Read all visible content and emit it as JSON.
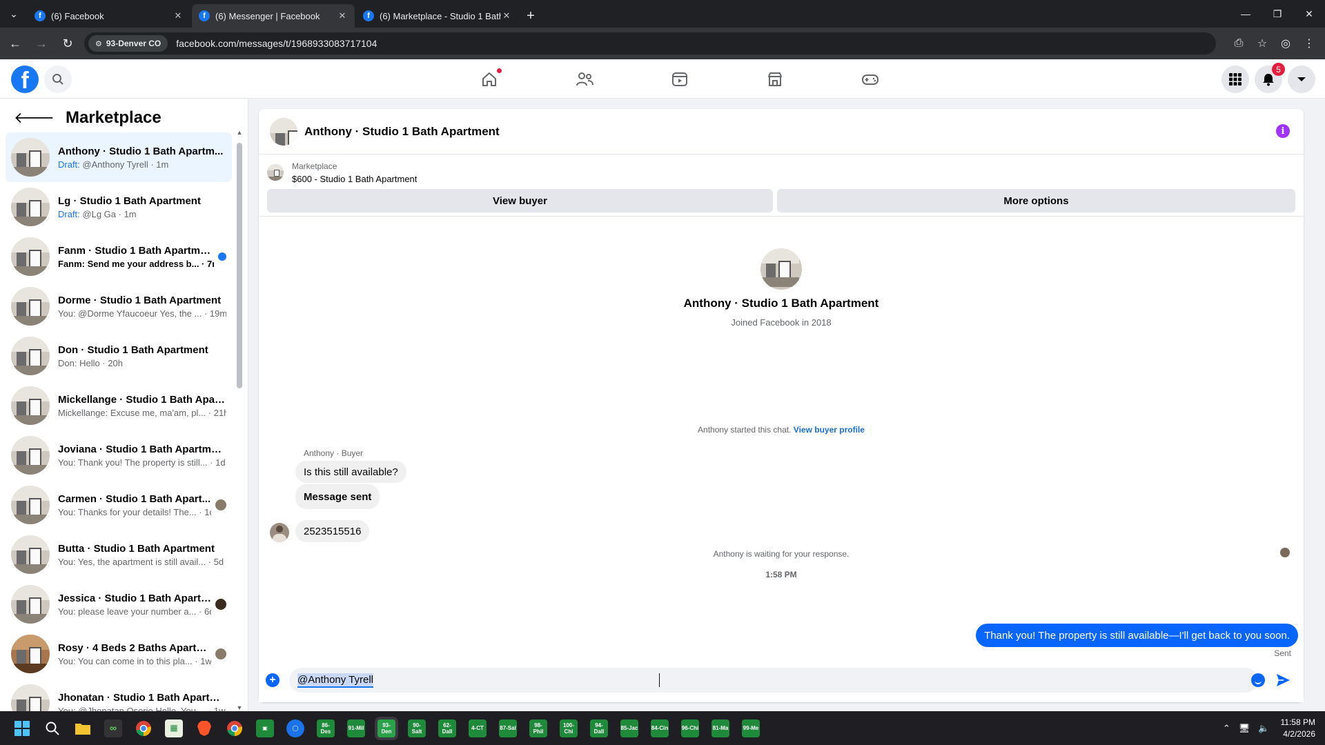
{
  "browser": {
    "tabs": [
      {
        "title": "(6) Facebook",
        "active": false
      },
      {
        "title": "(6) Messenger | Facebook",
        "active": true
      },
      {
        "title": "(6) Marketplace - Studio 1 Bath",
        "active": false
      }
    ],
    "location_chip": "93-Denver CO",
    "url": "facebook.com/messages/t/1968933083717104"
  },
  "header": {
    "notifications_badge": "5",
    "home_has_dot": true
  },
  "sidebar": {
    "title": "Marketplace",
    "conversations": [
      {
        "name": "Anthony · Studio 1 Bath Apartm...",
        "draft": "Draft:",
        "preview": " @Anthony Tyrell · 1m",
        "selected": true
      },
      {
        "name": "Lg · Studio 1 Bath Apartment",
        "draft": "Draft:",
        "preview": " @Lg Ga · 1m"
      },
      {
        "name": "Fanm · Studio 1 Bath Apartment",
        "draft": "",
        "preview": "Fanm: Send me your address b... · 7m",
        "unread": true
      },
      {
        "name": "Dorme · Studio 1 Bath Apartment",
        "draft": "",
        "preview": "You: @Dorme Yfaucoeur Yes, the ... · 19m"
      },
      {
        "name": "Don · Studio 1 Bath Apartment",
        "draft": "",
        "preview": "Don: Hello · 20h"
      },
      {
        "name": "Mickellange · Studio 1 Bath Apar...",
        "draft": "",
        "preview": "Mickellange: Excuse me, ma'am, pl... · 21h"
      },
      {
        "name": "Joviana · Studio 1 Bath Apartment",
        "draft": "",
        "preview": "You: Thank you! The property is still... · 1d"
      },
      {
        "name": "Carmen · Studio 1 Bath Apart...",
        "draft": "",
        "preview": "You: Thanks for your details! The... · 1d",
        "seen": true
      },
      {
        "name": "Butta · Studio 1 Bath Apartment",
        "draft": "",
        "preview": "You: Yes, the apartment is still avail... · 5d"
      },
      {
        "name": "Jessica · Studio 1 Bath Apartm...",
        "draft": "",
        "preview": "You: please leave your number a... · 6d",
        "seen": true,
        "seen_dark": true
      },
      {
        "name": "Rosy · 4 Beds 2 Baths Apartm...",
        "draft": "",
        "preview": "You: You can come in to this pla... · 1w",
        "seen": true,
        "warm": true
      },
      {
        "name": "Jhonatan · Studio 1 Bath Apartm...",
        "draft": "",
        "preview": "You: @Jhonatan Osorio Hello. You ... · 1w"
      }
    ]
  },
  "chat": {
    "title": "Anthony · Studio 1 Bath Apartment",
    "listing_sub": "Marketplace",
    "listing_title": "$600 - Studio 1 Bath Apartment",
    "view_buyer_label": "View buyer",
    "more_options_label": "More options",
    "profile_name": "Anthony · Studio 1 Bath Apartment",
    "profile_joined": "Joined Facebook in 2018",
    "started_text": "Anthony started this chat.",
    "view_profile_link": "View buyer profile",
    "sender_label": "Anthony · Buyer",
    "messages_in": [
      "Is this still available?",
      "Message sent",
      "2523515516"
    ],
    "waiting_text": "Anthony is waiting for your response.",
    "time_label": "1:58 PM",
    "message_out": "Thank you! The property is still available—I'll get back to you soon.",
    "sent_label": "Sent",
    "input_value": "@Anthony Tyrell"
  },
  "taskbar": {
    "apps": [
      "86-Des",
      "91-Mil",
      "93-Den",
      "90-Salt",
      "62-Dall",
      "4-CT",
      "87-Sal",
      "98-Phil",
      "100-Chi",
      "94-Dall",
      "85-Jac",
      "84-Cin",
      "96-Chi",
      "81-Ma",
      "99-Me"
    ],
    "active_app": "93-Den",
    "time": "11:58 PM",
    "date": "4/2/2026"
  }
}
